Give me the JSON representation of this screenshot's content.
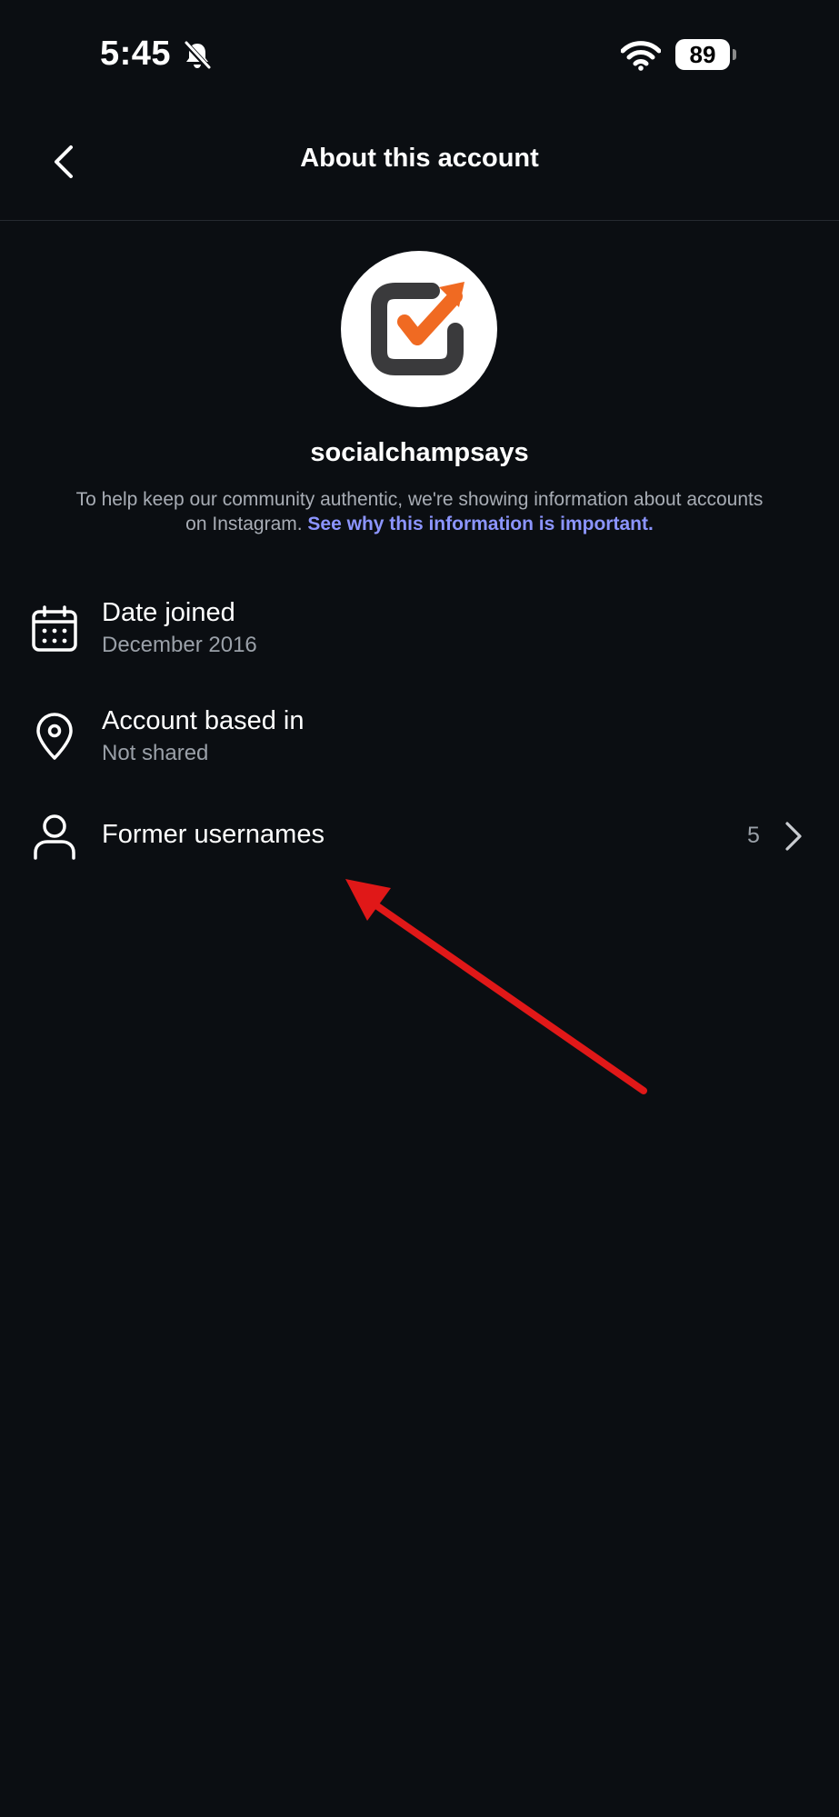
{
  "status_bar": {
    "time": "5:45",
    "battery": "89"
  },
  "header": {
    "title": "About this account"
  },
  "profile": {
    "username": "socialchampsays",
    "info_text": "To help keep our community authentic, we're showing information about accounts on Instagram.",
    "info_link": "See why this information is important."
  },
  "rows": [
    {
      "title": "Date joined",
      "subtitle": "December 2016",
      "icon": "calendar-icon"
    },
    {
      "title": "Account based in",
      "subtitle": "Not shared",
      "icon": "location-pin-icon"
    },
    {
      "title": "Former usernames",
      "count": "5",
      "icon": "person-icon"
    }
  ],
  "colors": {
    "background": "#0b0e12",
    "link": "#8c95ff",
    "logo_orange": "#f06a22",
    "logo_dark": "#3a3a3c",
    "annotation_red": "#e01818"
  }
}
